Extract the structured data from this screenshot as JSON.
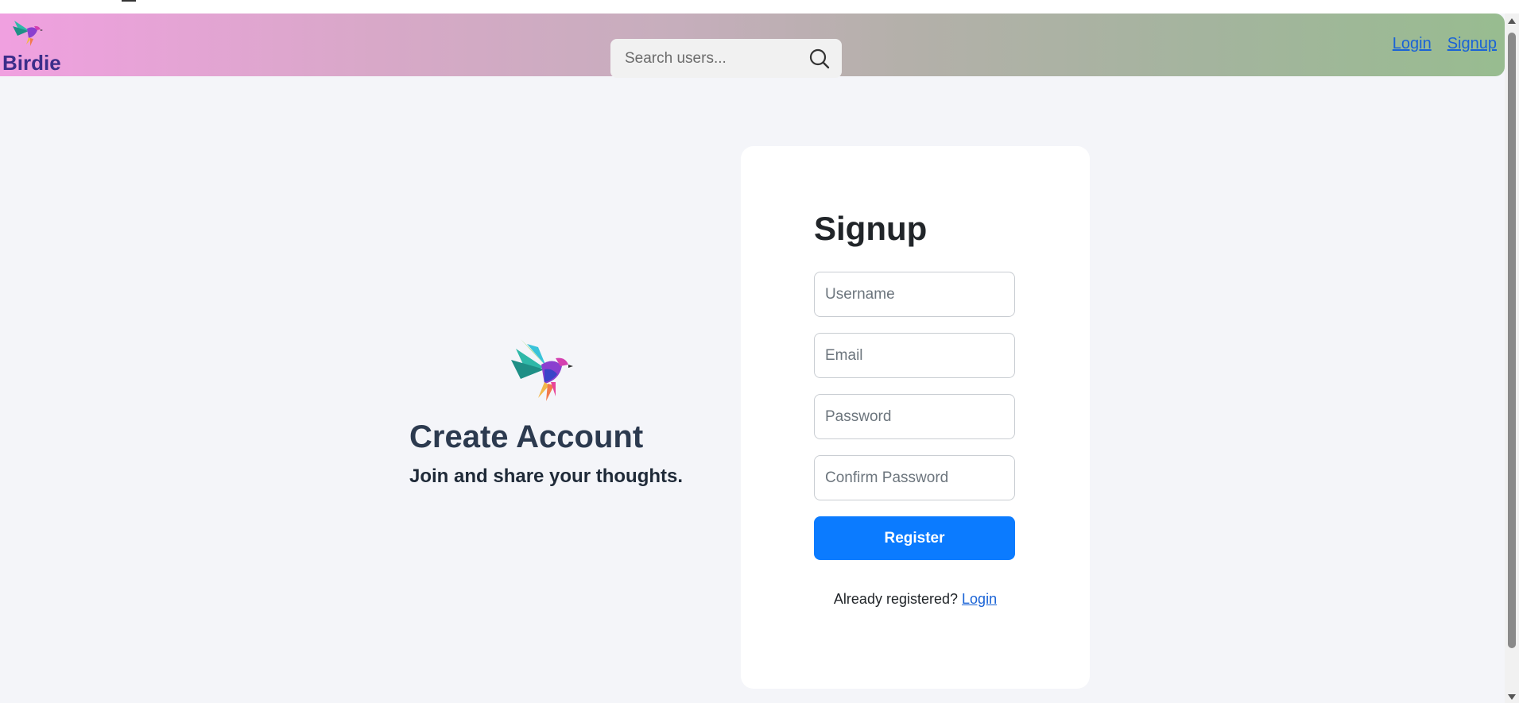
{
  "navbar": {
    "brand_name": "Birdie",
    "search_placeholder": "Search users...",
    "links": {
      "login": "Login",
      "signup": "Signup"
    }
  },
  "hero": {
    "title": "Create Account",
    "subtitle": "Join and share your thoughts."
  },
  "signup_form": {
    "title": "Signup",
    "fields": {
      "username_placeholder": "Username",
      "email_placeholder": "Email",
      "password_placeholder": "Password",
      "confirm_password_placeholder": "Confirm Password"
    },
    "register_label": "Register",
    "already_registered_text": "Already registered?",
    "login_link": "Login"
  },
  "colors": {
    "primary_button": "#0b7bff",
    "brand_text": "#3b2d8a",
    "link": "#1a63d6"
  },
  "icons": {
    "logo": "hummingbird-logo-icon",
    "search": "search-icon"
  }
}
